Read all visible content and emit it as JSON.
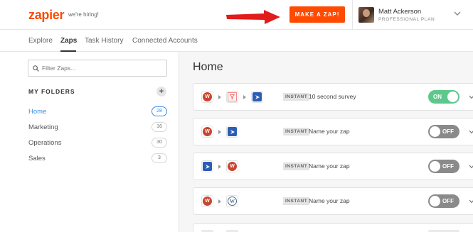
{
  "header": {
    "logo": "zapier",
    "hiring": "we're hiring!",
    "make_zap": "MAKE A ZAP!",
    "user_name": "Matt Ackerson",
    "user_plan": "PROFESSIONAL PLAN"
  },
  "nav": {
    "tabs": [
      {
        "label": "Explore",
        "active": false
      },
      {
        "label": "Zaps",
        "active": true
      },
      {
        "label": "Task History",
        "active": false
      },
      {
        "label": "Connected Accounts",
        "active": false
      }
    ]
  },
  "sidebar": {
    "filter_placeholder": "Filter Zaps...",
    "folders_title": "MY FOLDERS",
    "add_symbol": "+",
    "folders": [
      {
        "name": "Home",
        "count": "28",
        "active": true
      },
      {
        "name": "Marketing",
        "count": "16",
        "active": false
      },
      {
        "name": "Operations",
        "count": "30",
        "active": false
      },
      {
        "name": "Sales",
        "count": "3",
        "active": false
      }
    ]
  },
  "main": {
    "title": "Home",
    "zaps": [
      {
        "apps": [
          "wufoo-icon",
          "filter-icon",
          "flag-icon"
        ],
        "badge": "INSTANT",
        "name": "10 second survey",
        "toggle": "ON"
      },
      {
        "apps": [
          "wufoo-icon",
          "flag-icon"
        ],
        "badge": "INSTANT",
        "name": "Name your zap",
        "toggle": "OFF"
      },
      {
        "apps": [
          "flag-icon",
          "wufoo-icon"
        ],
        "badge": "INSTANT",
        "name": "Name your zap",
        "toggle": "OFF"
      },
      {
        "apps": [
          "wufoo-icon",
          "wordpress-icon"
        ],
        "badge": "INSTANT",
        "name": "Name your zap",
        "toggle": "OFF"
      }
    ]
  },
  "colors": {
    "brand": "#ff4a00",
    "link": "#3a8ee6",
    "toggle_on": "#5ec78b",
    "toggle_off": "#8a8a8a"
  }
}
